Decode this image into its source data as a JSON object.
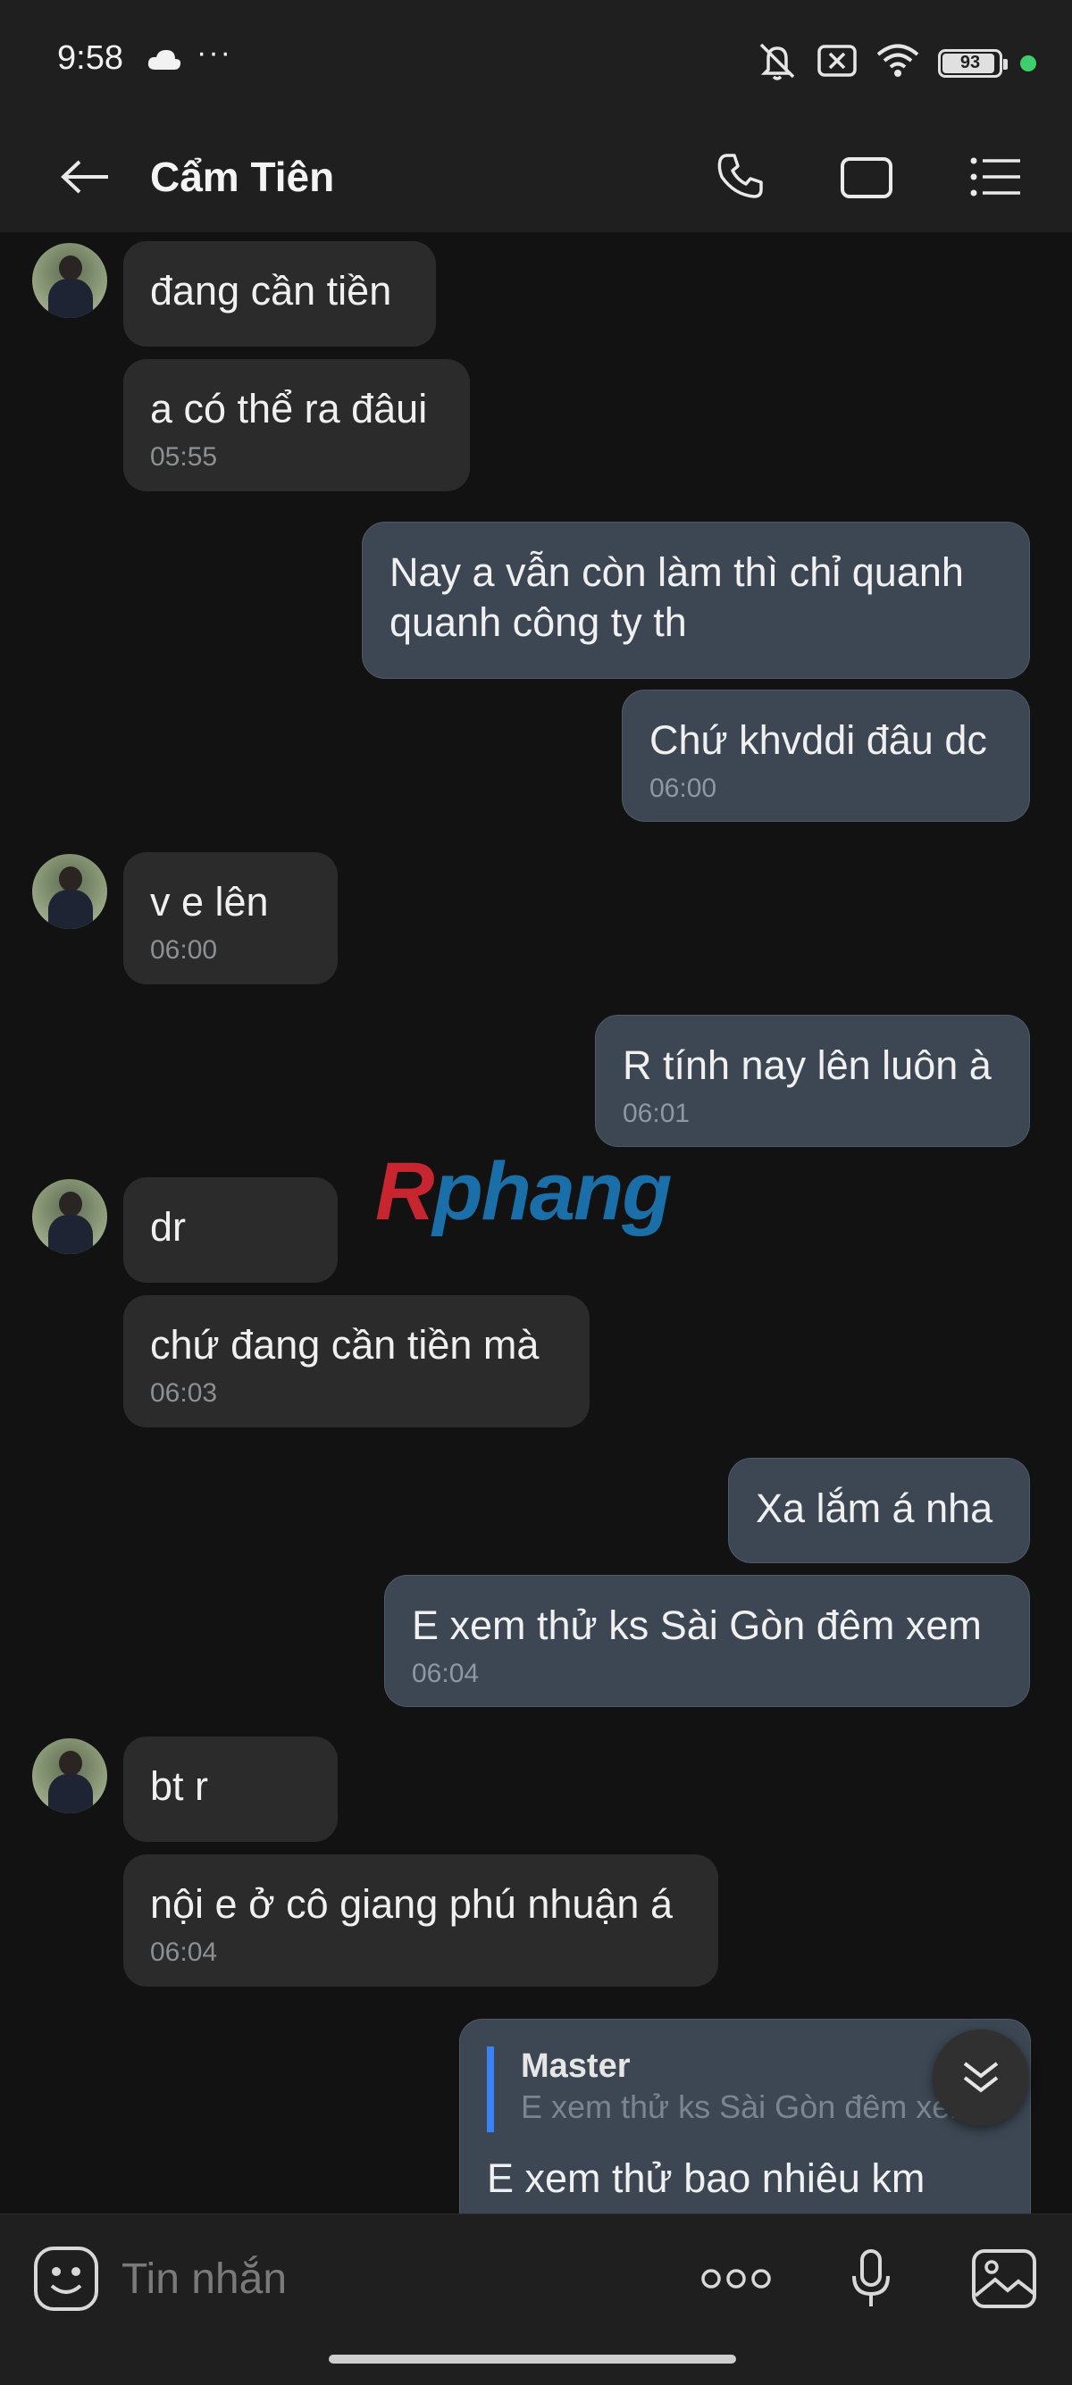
{
  "status_bar": {
    "time": "9:58",
    "more_dots": "···",
    "battery_level": "93",
    "icons": [
      "cloud-icon",
      "mute-icon",
      "no-sim-icon",
      "wifi-icon",
      "battery-icon",
      "active-dot-icon"
    ]
  },
  "header": {
    "contact_name": "Cẩm Tiên",
    "icons": [
      "back-arrow-icon",
      "phone-icon",
      "video-call-icon",
      "menu-list-icon"
    ]
  },
  "messages": [
    {
      "dir": "in",
      "text": "đang cần tiền",
      "time": ""
    },
    {
      "dir": "in",
      "text": "a có thể ra đâui",
      "time": "05:55"
    },
    {
      "dir": "out",
      "text": "Nay a vẫn còn làm thì chỉ quanh\nquanh công ty th",
      "time": ""
    },
    {
      "dir": "out",
      "text": "Chứ khvddi đâu dc",
      "time": "06:00"
    },
    {
      "dir": "in",
      "text": "v e lên",
      "time": "06:00"
    },
    {
      "dir": "out",
      "text": "R tính nay lên luôn à",
      "time": "06:01"
    },
    {
      "dir": "in",
      "text": "dr",
      "time": ""
    },
    {
      "dir": "in",
      "text": "chứ đang cần tiền mà",
      "time": "06:03"
    },
    {
      "dir": "out",
      "text": "Xa lắm á nha",
      "time": ""
    },
    {
      "dir": "out",
      "text": "E xem thử ks Sài Gòn đêm xem",
      "time": "06:04"
    },
    {
      "dir": "in",
      "text": "bt r",
      "time": ""
    },
    {
      "dir": "in",
      "text": "nội e ở cô giang phú nhuận á",
      "time": "06:04"
    }
  ],
  "reply_message": {
    "quote_author": "Master",
    "quote_text": "E xem thử ks Sài Gòn đêm xem",
    "text": "E xem thử bao nhiêu km"
  },
  "watermark": {
    "first": "R",
    "rest": "phang"
  },
  "input_bar": {
    "placeholder": "Tin nhắn",
    "icons": [
      "emoji-icon",
      "more-options-icon",
      "microphone-icon",
      "image-icon"
    ]
  },
  "colors": {
    "background": "#121212",
    "incoming_bubble": "#2b2b2b",
    "outgoing_bubble": "#3d4754",
    "reply_accent": "#3a82f7",
    "online_dot": "#3ecf6c"
  }
}
